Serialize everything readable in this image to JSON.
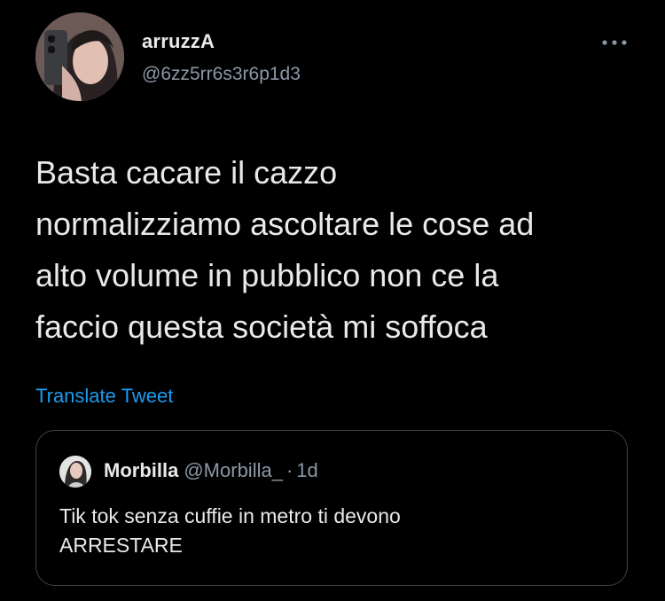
{
  "tweet": {
    "author_name": "arruzzA",
    "author_handle": "@6zz5rr6s3r6p1d3",
    "text": "Basta cacare il cazzo\nnormalizziamo ascoltare le cose ad\nalto volume in pubblico non ce la\nfaccio questa società mi soffoca",
    "translate_label": "Translate Tweet",
    "more_icon": "more-horizontal-icon"
  },
  "quote": {
    "author_name": "Morbilla",
    "author_handle": "@Morbilla_",
    "separator": "·",
    "time": "1d",
    "text": "Tik tok senza cuffie in metro ti devono\nARRESTARE"
  },
  "colors": {
    "background": "#000000",
    "text": "#e7e9ea",
    "secondary": "#8b98a5",
    "link": "#1d9bf0",
    "border": "#3e4144"
  }
}
